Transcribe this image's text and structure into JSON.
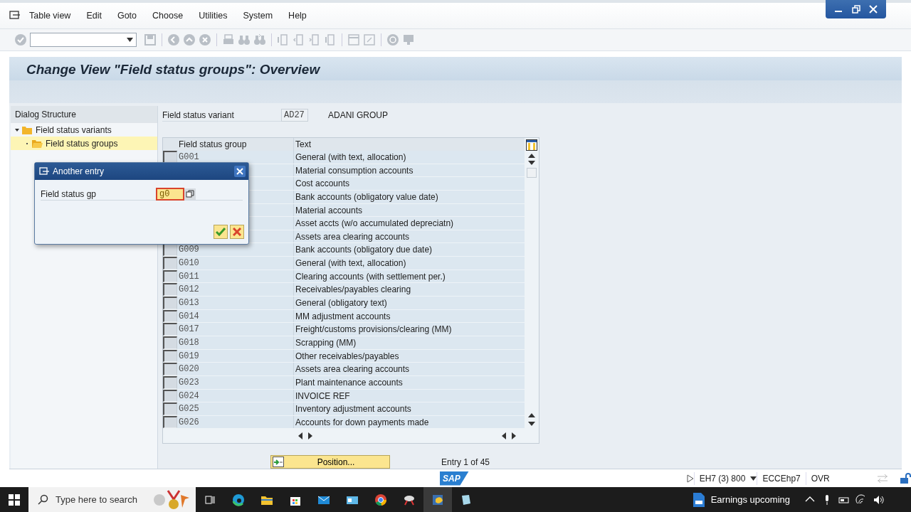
{
  "menu": [
    "Table view",
    "Edit",
    "Goto",
    "Choose",
    "Utilities",
    "System",
    "Help"
  ],
  "window": {
    "title": "Change View \"Field status groups\": Overview"
  },
  "dialog_structure": {
    "title": "Dialog Structure",
    "items": [
      {
        "label": "Field status variants",
        "expanded": true,
        "selected": false,
        "children": [
          {
            "label": "Field status groups",
            "selected": true
          }
        ]
      }
    ]
  },
  "variant": {
    "label": "Field status variant",
    "value": "AD27",
    "description": "ADANI GROUP"
  },
  "table": {
    "columns": [
      "Field status group",
      "Text"
    ],
    "rows": [
      {
        "group": "G001",
        "text": "General (with text, allocation)",
        "selected": false
      },
      {
        "text": "Material consumption accounts"
      },
      {
        "text": "Cost accounts"
      },
      {
        "text": "Bank accounts (obligatory value date)"
      },
      {
        "text": "Material accounts"
      },
      {
        "text": "Asset accts (w/o accumulated depreciatn)"
      },
      {
        "text": "Assets area clearing accounts"
      },
      {
        "group": "G009",
        "text": "Bank accounts (obligatory due date)",
        "selected": false
      },
      {
        "group": "G010",
        "text": "General (with text, allocation)",
        "selected": false
      },
      {
        "group": "G011",
        "text": "Clearing accounts (with settlement per.)",
        "selected": false
      },
      {
        "group": "G012",
        "text": "Receivables/payables clearing",
        "selected": false
      },
      {
        "group": "G013",
        "text": "General (obligatory text)",
        "selected": false
      },
      {
        "group": "G014",
        "text": "MM adjustment accounts",
        "selected": false
      },
      {
        "group": "G017",
        "text": "Freight/customs provisions/clearing (MM)",
        "selected": false
      },
      {
        "group": "G018",
        "text": "Scrapping (MM)",
        "selected": false
      },
      {
        "group": "G019",
        "text": "Other receivables/payables",
        "selected": false
      },
      {
        "group": "G020",
        "text": "Assets area clearing accounts",
        "selected": false
      },
      {
        "group": "G023",
        "text": "Plant maintenance accounts",
        "selected": false
      },
      {
        "group": "G024",
        "text": "INVOICE REF",
        "selected": false
      },
      {
        "group": "G025",
        "text": "Inventory adjustment accounts",
        "selected": false
      },
      {
        "group": "G026",
        "text": "Accounts for down payments made",
        "selected": false
      }
    ]
  },
  "position_button": "Position...",
  "entry_info": "Entry 1 of 45",
  "popup": {
    "title": "Another entry",
    "field_label": "Field status gp",
    "value": "g0"
  },
  "status_bar": {
    "logo": "SAP",
    "system": "EH7 (3) 800",
    "server": "ECCEhp7",
    "mode": "OVR"
  },
  "taskbar": {
    "search_placeholder": "Type here to search",
    "news": "Earnings upcoming"
  }
}
